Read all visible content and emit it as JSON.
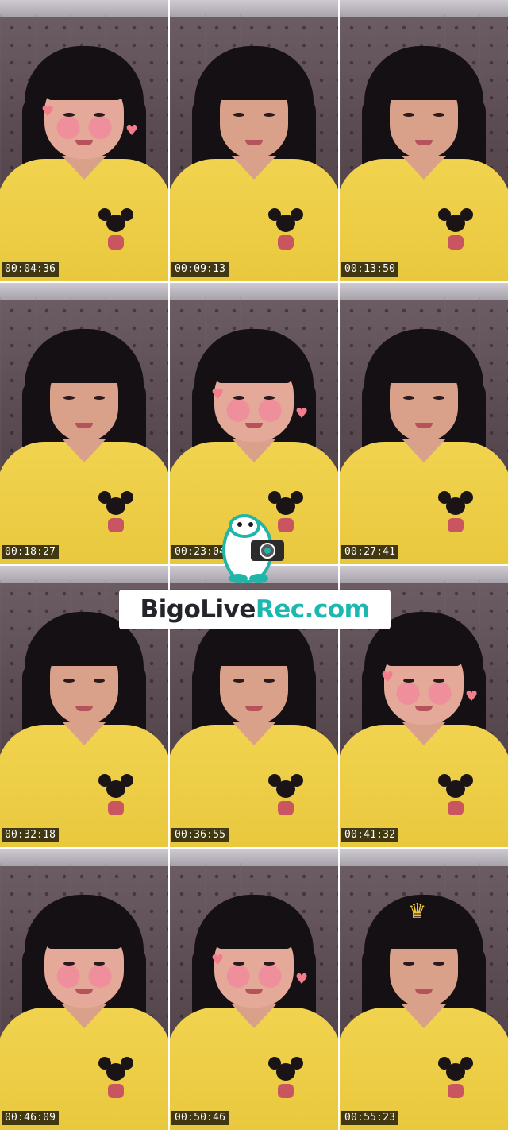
{
  "brand": {
    "name_part1": "BigoLive",
    "name_part2": "Rec.com",
    "color_dark": "#23252b",
    "color_accent": "#1bb8b0",
    "mascot_icon": "camera-mascot-icon"
  },
  "frames": [
    {
      "timestamp": "00:04:36",
      "filter": true,
      "hearts": true
    },
    {
      "timestamp": "00:09:13",
      "filter": false,
      "hearts": false
    },
    {
      "timestamp": "00:13:50",
      "filter": false,
      "hearts": false
    },
    {
      "timestamp": "00:18:27",
      "filter": false,
      "hearts": false
    },
    {
      "timestamp": "00:23:04",
      "filter": true,
      "hearts": true
    },
    {
      "timestamp": "00:27:41",
      "filter": false,
      "hearts": false
    },
    {
      "timestamp": "00:32:18",
      "filter": false,
      "hearts": false
    },
    {
      "timestamp": "00:36:55",
      "filter": false,
      "hearts": false
    },
    {
      "timestamp": "00:41:32",
      "filter": true,
      "hearts": true
    },
    {
      "timestamp": "00:46:09",
      "filter": true,
      "hearts": false
    },
    {
      "timestamp": "00:50:46",
      "filter": true,
      "hearts": true
    },
    {
      "timestamp": "00:55:23",
      "filter": false,
      "hearts": false,
      "crown": true
    }
  ],
  "colors": {
    "shirt": "#f1d34f",
    "hair": "#151013",
    "wall": "#5b4b52",
    "blush": "#ef8f9c",
    "crown": "#f2c43a"
  }
}
